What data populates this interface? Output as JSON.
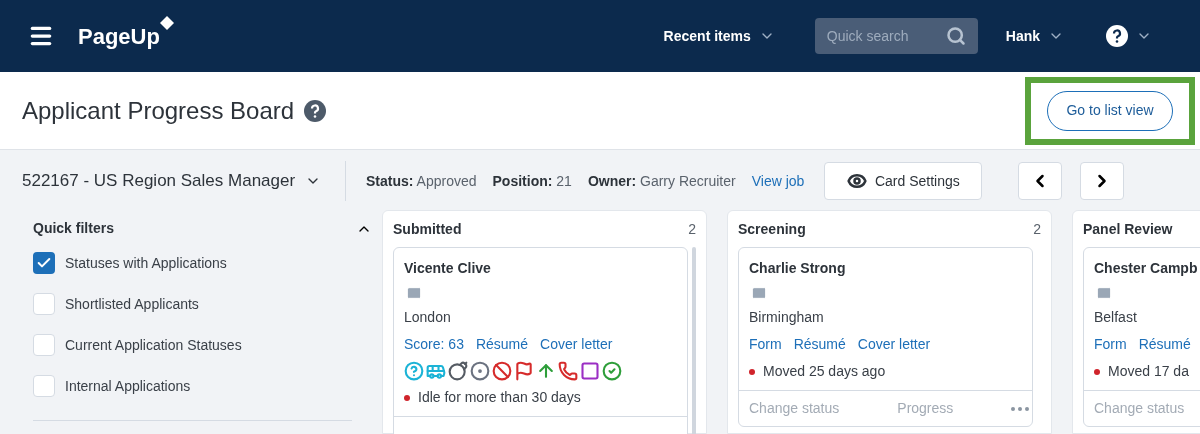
{
  "navbar": {
    "logo": "PageUp",
    "recent_items": "Recent items",
    "search": {
      "placeholder": "Quick search"
    },
    "user": "Hank"
  },
  "header": {
    "title": "Applicant Progress Board",
    "list_view_button": {
      "label": "Go to list view",
      "highlighted": true
    }
  },
  "job_bar": {
    "job": "522167 - US Region Sales Manager",
    "details": [
      {
        "label": "Status:",
        "value": "Approved"
      },
      {
        "label": "Position:",
        "value": "21"
      },
      {
        "label": "Owner:",
        "value": "Garry Recruiter"
      }
    ],
    "view_job": "View job",
    "card_settings": "Card Settings"
  },
  "quick_filters": {
    "title": "Quick filters",
    "expanded": true,
    "items": [
      {
        "label": "Statuses with Applications",
        "checked": true
      },
      {
        "label": "Shortlisted Applicants",
        "checked": false
      },
      {
        "label": "Current Application Statuses",
        "checked": false
      },
      {
        "label": "Internal Applications",
        "checked": false
      }
    ]
  },
  "columns": [
    {
      "title": "Submitted",
      "count": "2",
      "scrollbar": true,
      "cards": [
        {
          "name": "Vicente Clive",
          "city": "London",
          "links": [
            "Score: 63",
            "Résumé",
            "Cover letter"
          ],
          "icons": [
            {
              "color": "#1bb3d6"
            },
            {
              "color": "#1bb3d6"
            },
            {
              "color": "#555b63"
            },
            {
              "color": "#6b7280"
            },
            {
              "color": "#d62b2b"
            },
            {
              "color": "#d62b2b"
            },
            {
              "color": "#2e9e3a"
            },
            {
              "color": "#d62b2b"
            },
            {
              "color": "#9b2fc4"
            },
            {
              "color": "#2e9e3a"
            }
          ],
          "status": "Idle for more than 30 days"
        }
      ]
    },
    {
      "title": "Screening",
      "count": "2",
      "scrollbar": false,
      "cards": [
        {
          "name": "Charlie Strong",
          "city": "Birmingham",
          "links": [
            "Form",
            "Résumé",
            "Cover letter"
          ],
          "status": "Moved 25 days ago",
          "footer": [
            "Change status",
            "Progress"
          ]
        }
      ]
    },
    {
      "title": "Panel Review",
      "scrollbar": false,
      "cards": [
        {
          "name": "Chester Campb",
          "city": "Belfast",
          "links": [
            "Form",
            "Résumé"
          ],
          "status": "Moved 17 da",
          "footer": [
            "Change status"
          ]
        }
      ]
    }
  ]
}
